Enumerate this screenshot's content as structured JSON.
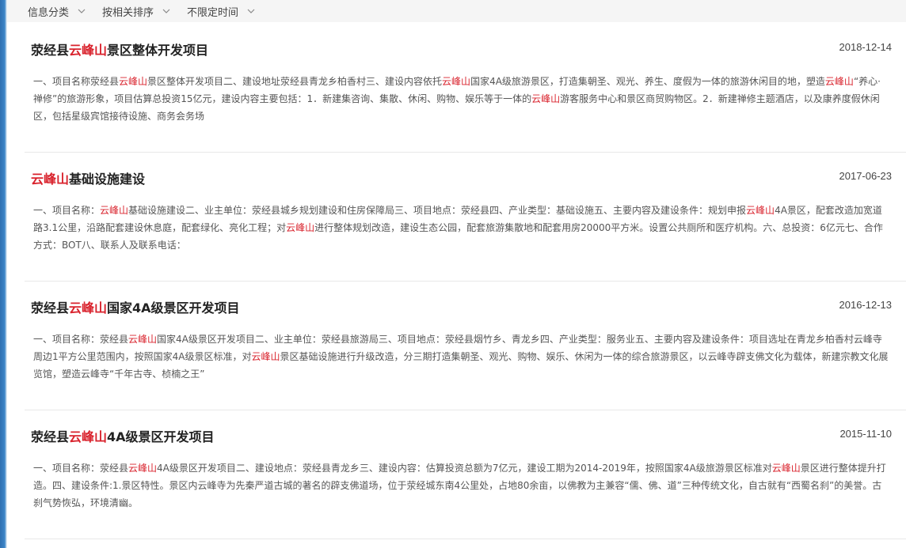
{
  "filters": [
    {
      "label": "信息分类"
    },
    {
      "label": "按相关排序"
    },
    {
      "label": "不限定时间"
    }
  ],
  "results": [
    {
      "title_parts": [
        "荥经县",
        "云峰山",
        "景区整体开发项目"
      ],
      "date": "2018-12-14",
      "desc_parts": [
        "一、项目名称荥经县",
        "云峰山",
        "景区整体开发项目二、建设地址荥经县青龙乡柏香村三、建设内容依托",
        "云峰山",
        "国家4A级旅游景区，打造集朝圣、观光、养生、度假为一体的旅游休闲目的地，塑造",
        "云峰山",
        "“养心·禅修”的旅游形象，项目估算总投资15亿元，建设内容主要包括：1．新建集咨询、集散、休闲、购物、娱乐等于一体的",
        "云峰山",
        "游客服务中心和景区商贸购物区。2．新建禅修主题酒店，以及康养度假休闲区，包括星级宾馆接待设施、商务会务场"
      ]
    },
    {
      "title_parts": [
        "",
        "云峰山",
        "基础设施建设"
      ],
      "date": "2017-06-23",
      "desc_parts": [
        "一、项目名称：",
        "云峰山",
        "基础设施建设二、业主单位：荥经县城乡规划建设和住房保障局三、项目地点：荥经县四、产业类型：基础设施五、主要内容及建设条件：规划申报",
        "云峰山",
        "4A景区，配套改造加宽道路3.1公里，沿路配套建设休息庭，配套绿化、亮化工程；对",
        "云峰山",
        "进行整体规划改造，建设生态公园，配套旅游集散地和配套用房20000平方米。设置公共厕所和医疗机构。六、总投资：6亿元七、合作方式：BOT八、联系人及联系电话："
      ]
    },
    {
      "title_parts": [
        "荥经县",
        "云峰山",
        "国家4A级景区开发项目"
      ],
      "date": "2016-12-13",
      "desc_parts": [
        "一、项目名称：荥经县",
        "云峰山",
        "国家4A级景区开发项目二、业主单位：荥经县旅游局三、项目地点：荥经县烟竹乡、青龙乡四、产业类型：服务业五、主要内容及建设条件：项目选址在青龙乡柏香村云峰寺周边1平方公里范围内，按照国家4A级景区标准，对",
        "云峰山",
        "景区基础设施进行升级改造，分三期打造集朝圣、观光、购物、娱乐、休闲为一体的综合旅游景区，以云峰寺辟支佛文化为载体，新建宗教文化展览馆，塑造云峰寺“千年古寺、桢楠之王”"
      ]
    },
    {
      "title_parts": [
        "荥经县",
        "云峰山",
        "4A级景区开发项目"
      ],
      "date": "2015-11-10",
      "desc_parts": [
        "一、项目名称：荥经县",
        "云峰山",
        "4A级景区开发项目二、建设地点：荥经县青龙乡三、建设内容：估算投资总额为7亿元，建设工期为2014-2019年，按照国家4A级旅游景区标准对",
        "云峰山",
        "景区进行整体提升打造。四、建设条件:1.景区特性。景区内云峰寺为先秦严道古城的著名的辟支佛道场，位于荥经城东南4公里处，占地80余亩，以佛教为主兼容“儒、佛、道”三种传统文化，自古就有“西蜀名刹”的美誉。古刹气势恢弘，环境清幽。"
      ]
    }
  ],
  "colors": {
    "highlight": "#d9232d"
  },
  "icons": {
    "filter_chevron": "chevron-down-icon"
  }
}
